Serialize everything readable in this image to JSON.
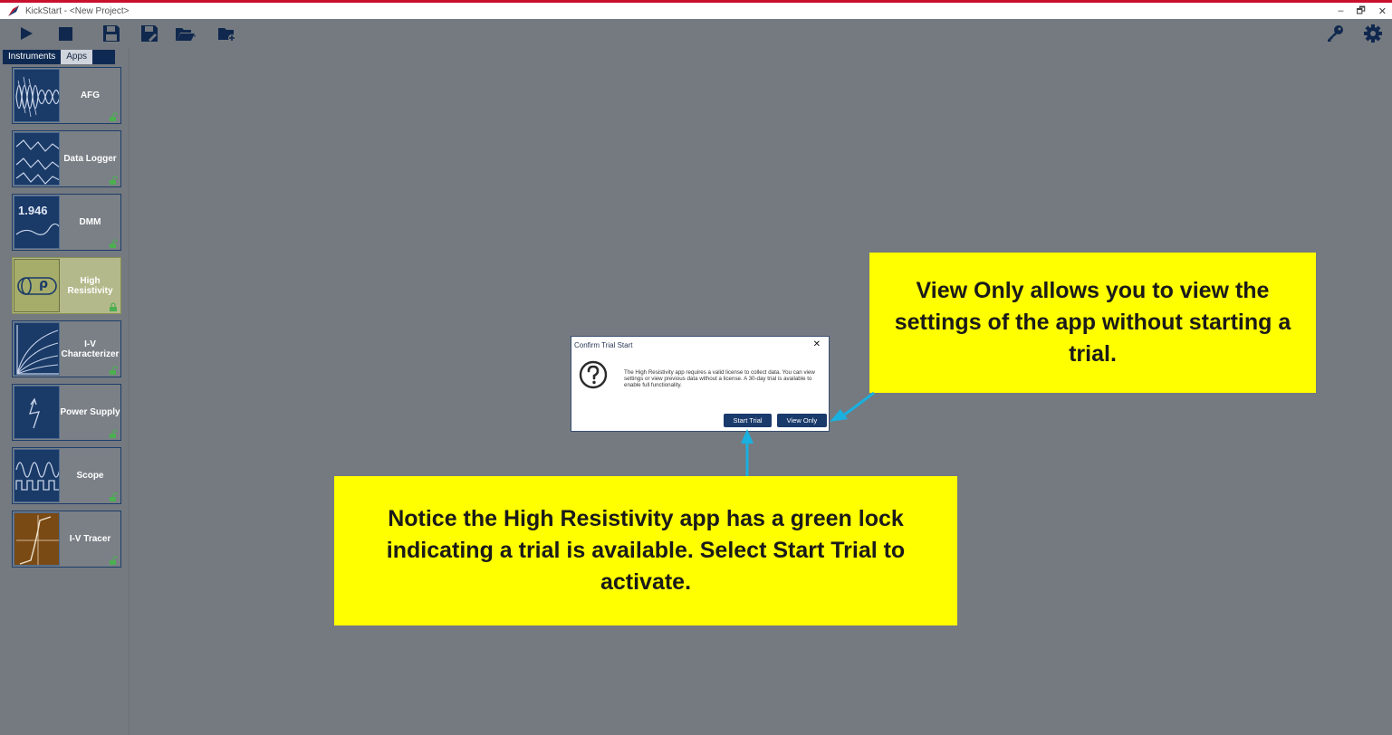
{
  "window": {
    "title": "KickStart - <New Project>",
    "controls": [
      "–",
      "🗗",
      "✕"
    ]
  },
  "toolbar": {
    "left_icons": [
      "run-icon",
      "stop-icon",
      "save-icon",
      "save-as-icon",
      "open-folder-icon",
      "new-folder-icon"
    ],
    "right_icons": [
      "license-key-icon",
      "settings-gear-icon"
    ]
  },
  "sidebar": {
    "tabs": [
      {
        "label": "Instruments",
        "active": false
      },
      {
        "label": "Apps",
        "active": true
      }
    ],
    "apps": [
      {
        "label": "AFG",
        "lock": "unlocked",
        "icon": "afg-waveform-icon"
      },
      {
        "label": "Data Logger",
        "lock": "unlocked",
        "icon": "data-logger-icon"
      },
      {
        "label": "DMM",
        "lock": "unlocked",
        "icon": "dmm-icon",
        "thumb_text": "1.946"
      },
      {
        "label": "High Resistivity",
        "lock": "trial",
        "icon": "high-resistivity-icon",
        "thumb_text": "ρ",
        "selected": true
      },
      {
        "label": "I-V Characterizer",
        "lock": "unlocked",
        "icon": "iv-characterizer-icon"
      },
      {
        "label": "Power Supply",
        "lock": "unlocked",
        "icon": "power-supply-icon"
      },
      {
        "label": "Scope",
        "lock": "unlocked",
        "icon": "scope-icon"
      },
      {
        "label": "I-V Tracer",
        "lock": "unlocked",
        "icon": "iv-tracer-icon"
      }
    ]
  },
  "dialog": {
    "title": "Confirm Trial Start",
    "close": "✕",
    "icon": "question-icon",
    "message": "The High Resistivity app requires a valid license to collect data. You can view settings or view previous data without a license.  A 30-day trial is available to enable full functionality.",
    "buttons": {
      "start_trial": "Start Trial",
      "view_only": "View Only"
    }
  },
  "callouts": {
    "view_only": "View Only allows you to view the settings of the app without starting a trial.",
    "start_trial": "Notice the High Resistivity app has a green lock indicating a trial is available. Select Start Trial to activate."
  },
  "colors": {
    "accent_red": "#c8102e",
    "navy": "#1a3a6c",
    "callout_yellow": "#ffff00",
    "arrow_cyan": "#1ab0e0",
    "trial_lock_green": "#4caf50"
  }
}
